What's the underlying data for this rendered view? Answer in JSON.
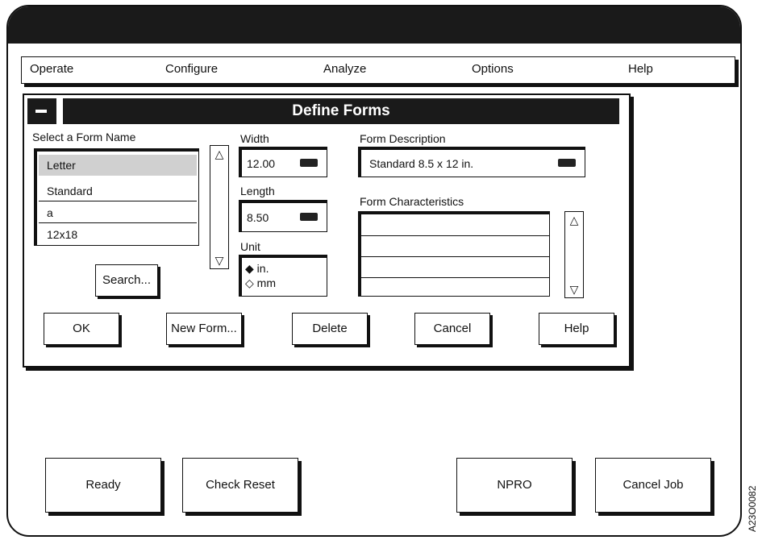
{
  "menu": [
    "Operate",
    "Configure",
    "Analyze",
    "Options",
    "Help"
  ],
  "dialog": {
    "title": "Define Forms",
    "select_label": "Select a Form Name",
    "forms": [
      "Letter",
      "Standard",
      "a",
      "12x18"
    ],
    "width_label": "Width",
    "width_value": "12.00",
    "length_label": "Length",
    "length_value": "8.50",
    "unit_label": "Unit",
    "unit_options": [
      "in.",
      "mm"
    ],
    "unit_selected": "in.",
    "description_label": "Form Description",
    "description_value": "Standard 8.5 x 12 in.",
    "characteristics_label": "Form Characteristics",
    "characteristics_rows": [
      "",
      "",
      "",
      ""
    ],
    "search_label": "Search...",
    "buttons": {
      "ok": "OK",
      "new_form": "New Form...",
      "delete": "Delete",
      "cancel": "Cancel",
      "help": "Help"
    }
  },
  "bottom_buttons": {
    "ready": "Ready",
    "check_reset": "Check Reset",
    "npro": "NPRO",
    "cancel_job": "Cancel Job"
  },
  "figure_id": "A23O0082",
  "icons": {
    "unit_selected_icon": "◆",
    "unit_unselected_icon": "◇",
    "scroll_up_icon": "△",
    "scroll_down_icon": "▽"
  }
}
